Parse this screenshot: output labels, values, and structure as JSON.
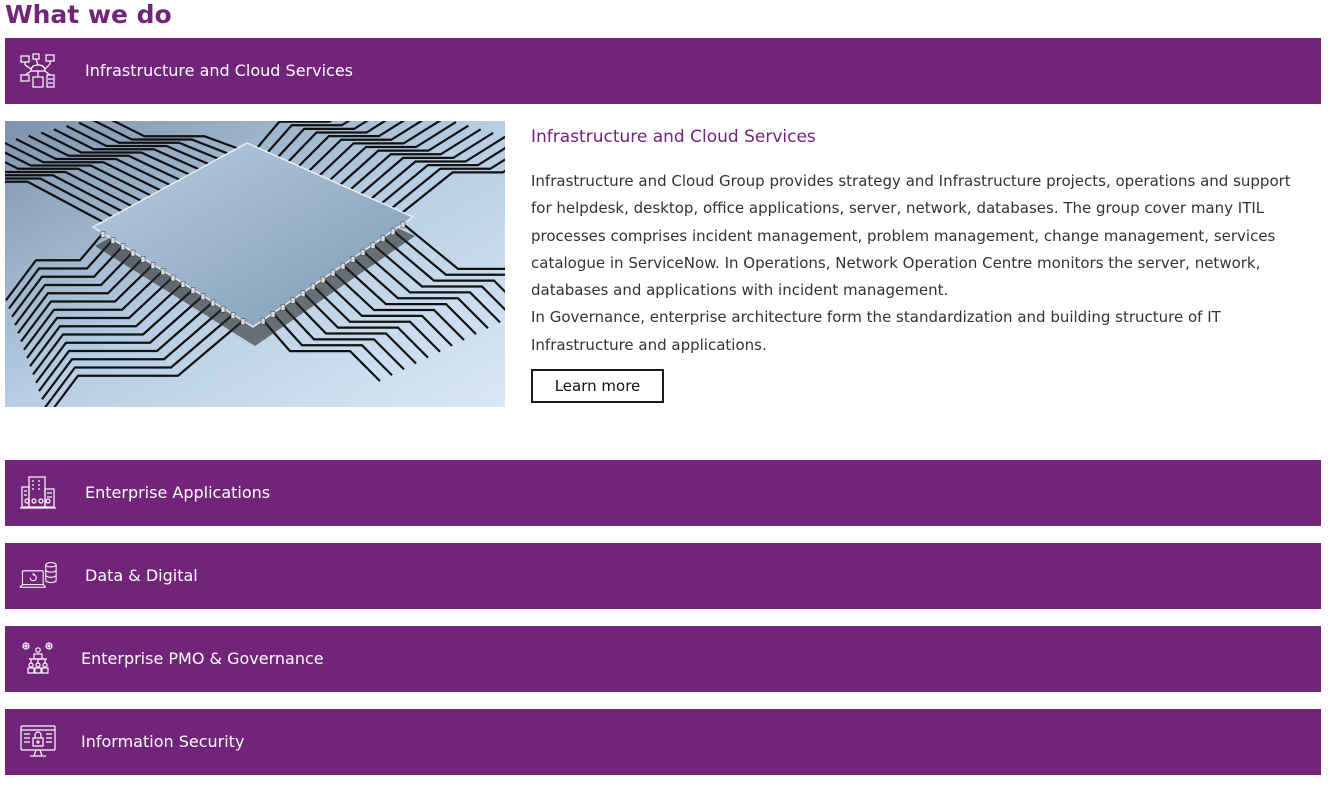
{
  "section": {
    "title": "What we do"
  },
  "colors": {
    "brand_purple": "#72247a",
    "text_dark": "#333333",
    "white": "#ffffff"
  },
  "accordion": {
    "items": [
      {
        "label": "Infrastructure and Cloud Services",
        "icon": "network-devices-icon",
        "expanded": true
      },
      {
        "label": "Enterprise Applications",
        "icon": "building-icon",
        "expanded": false
      },
      {
        "label": "Data & Digital",
        "icon": "laptop-database-icon",
        "expanded": false
      },
      {
        "label": "Enterprise PMO & Governance",
        "icon": "team-gears-icon",
        "expanded": false
      },
      {
        "label": "Information Security",
        "icon": "secure-monitor-icon",
        "expanded": false
      }
    ]
  },
  "panel": {
    "image": "circuit-chip-image",
    "title": "Infrastructure and Cloud Services",
    "paragraph_1": "Infrastructure and Cloud Group provides strategy and Infrastructure projects, operations and support for helpdesk, desktop, office applications, server, network, databases. The group cover many ITIL processes comprises incident management, problem management, change management, services catalogue in ServiceNow. In Operations, Network Operation Centre monitors the server, network, databases and applications with incident management.",
    "paragraph_2": "In Governance, enterprise architecture form the standardization and building structure of IT Infrastructure and applications.",
    "button_label": "Learn more"
  }
}
